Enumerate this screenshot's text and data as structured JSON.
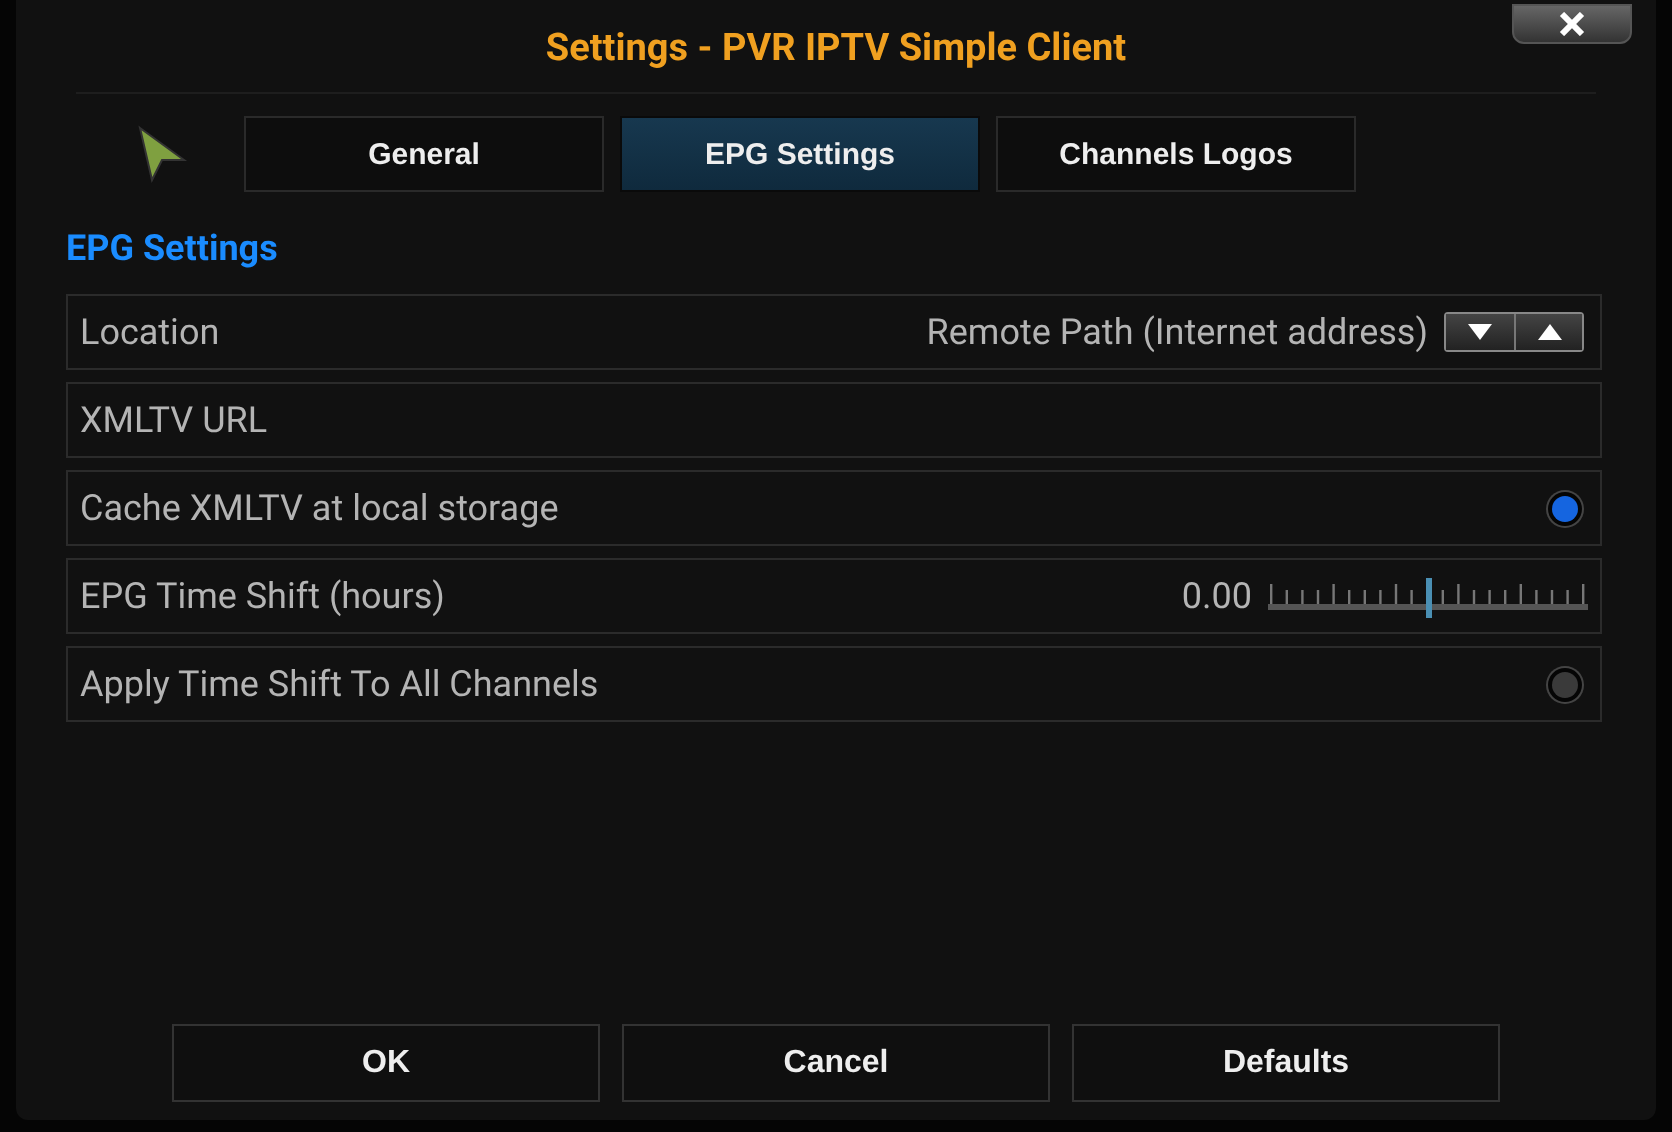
{
  "window": {
    "title": "Settings - PVR IPTV Simple Client"
  },
  "tabs": [
    {
      "label": "General",
      "selected": false
    },
    {
      "label": "EPG Settings",
      "selected": true
    },
    {
      "label": "Channels Logos",
      "selected": false
    }
  ],
  "section_title": "EPG Settings",
  "settings": [
    {
      "kind": "spinner",
      "label": "Location",
      "value": "Remote Path (Internet address)"
    },
    {
      "kind": "text",
      "label": "XMLTV URL"
    },
    {
      "kind": "toggle",
      "label": "Cache XMLTV at local storage",
      "on": true
    },
    {
      "kind": "slider",
      "label": "EPG Time Shift (hours)",
      "value": "0.00",
      "level": 0.5
    },
    {
      "kind": "toggle",
      "label": "Apply Time Shift To All Channels",
      "on": false
    }
  ],
  "buttons": [
    "OK",
    "Cancel",
    "Defaults"
  ]
}
